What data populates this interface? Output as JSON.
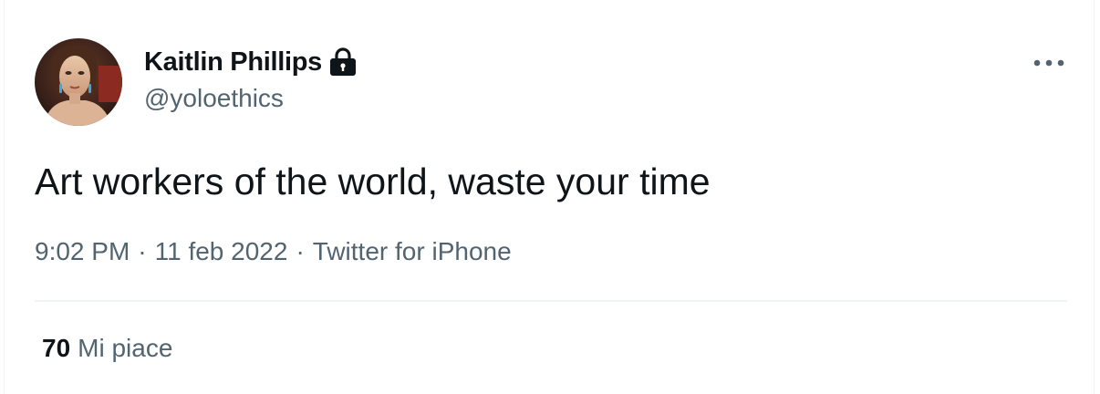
{
  "tweet": {
    "author": {
      "name": "Kaitlin Phillips",
      "handle": "@yoloethics",
      "protected_icon": "lock-icon",
      "avatar_icon": "avatar-portrait"
    },
    "text": "Art workers of the world, waste your time",
    "time": "9:02 PM",
    "date": "11 feb 2022",
    "separator": "·",
    "source": "Twitter for iPhone",
    "more_icon": "more-horizontal-icon",
    "stats": {
      "likes_count": "70",
      "likes_label": "Mi piace"
    }
  },
  "colors": {
    "primary_text": "#0f1419",
    "secondary_text": "#536471",
    "divider": "#eff3f4"
  }
}
